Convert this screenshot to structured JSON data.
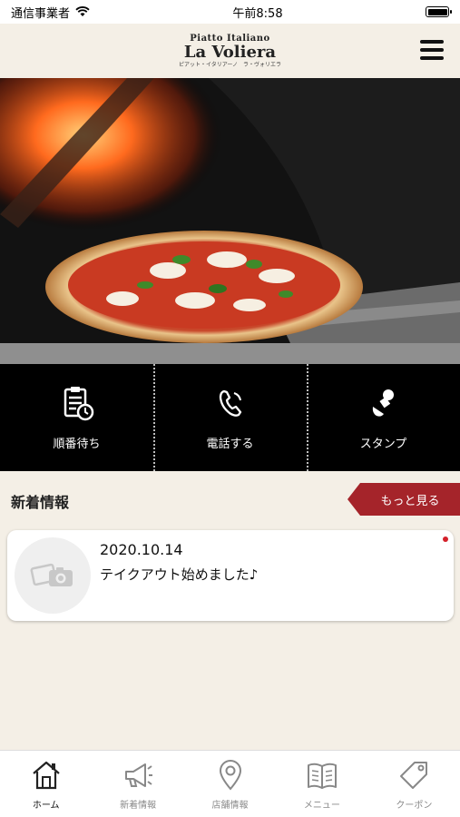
{
  "status_bar": {
    "carrier": "通信事業者",
    "time": "午前8:58",
    "battery_level": 1.0
  },
  "header": {
    "logo_top": "Piatto Italiano",
    "logo_main": "La Voliera",
    "logo_sub": "ピアット・イタリアーノ　ラ・ヴォリエラ"
  },
  "hero": {
    "image": "pizza-in-wood-fired-oven"
  },
  "actions": [
    {
      "label": "順番待ち",
      "icon": "clipboard-clock-icon"
    },
    {
      "label": "電話する",
      "icon": "phone-icon"
    },
    {
      "label": "スタンプ",
      "icon": "stamp-icon"
    }
  ],
  "news": {
    "title": "新着情報",
    "more_label": "もっと見る",
    "items": [
      {
        "date": "2020.10.14",
        "text": "テイクアウト始めました♪",
        "unread": true,
        "thumb_icon": "camera-placeholder-icon"
      }
    ]
  },
  "tabs": [
    {
      "label": "ホーム",
      "icon": "home-icon",
      "active": true
    },
    {
      "label": "新着情報",
      "icon": "megaphone-icon",
      "active": false
    },
    {
      "label": "店舗情報",
      "icon": "map-pin-icon",
      "active": false
    },
    {
      "label": "メニュー",
      "icon": "book-icon",
      "active": false
    },
    {
      "label": "クーポン",
      "icon": "coupon-tag-icon",
      "active": false
    }
  ],
  "colors": {
    "accent": "#a5242a",
    "background": "#f4efe6",
    "action_bar": "#000000"
  }
}
